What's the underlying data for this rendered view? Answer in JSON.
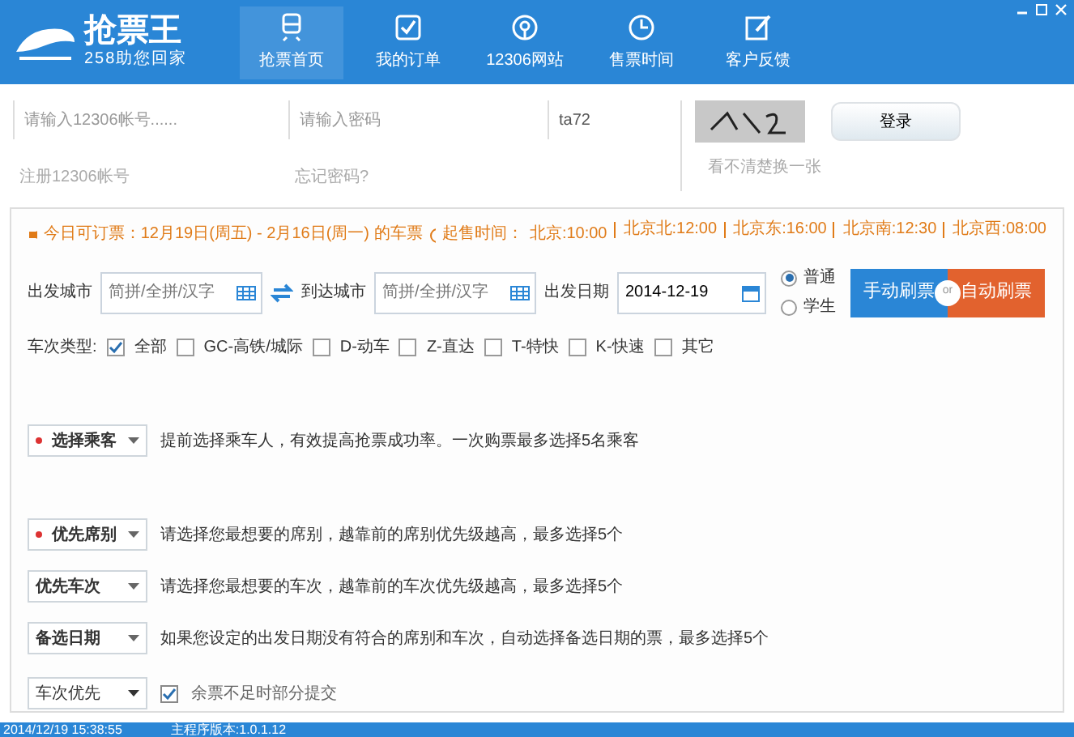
{
  "header": {
    "logo": "抢票王",
    "slogan": "258助您回家",
    "nav": [
      {
        "label": "抢票首页",
        "selected": true
      },
      {
        "label": "我的订单",
        "selected": false
      },
      {
        "label": "12306网站",
        "selected": false
      },
      {
        "label": "售票时间",
        "selected": false
      },
      {
        "label": "客户反馈",
        "selected": false
      }
    ]
  },
  "login": {
    "account": {
      "placeholder": "请输入12306帐号......"
    },
    "password": {
      "placeholder": "请输入密码"
    },
    "captcha": {
      "value": "ta72"
    },
    "login_button": "登录",
    "register_link": "注册12306帐号",
    "forgot_link": "忘记密码?",
    "refresh_captcha_link": "看不清楚换一张"
  },
  "notice": {
    "text": "今日可订票：12月19日(周五) - 2月16日(周一) 的车票",
    "sale_label": "起售时间：",
    "sale_times": [
      "北京:10:00",
      "北京北:12:00",
      "北京东:16:00",
      "北京南:12:30",
      "北京西:08:00"
    ]
  },
  "search": {
    "from_label": "出发城市",
    "from": {
      "placeholder": "简拼/全拼/汉字"
    },
    "to_label": "到达城市",
    "to": {
      "placeholder": "简拼/全拼/汉字"
    },
    "date_label": "出发日期",
    "date": "2014-12-19",
    "ticket_types": [
      {
        "label": "普通",
        "selected": true
      },
      {
        "label": "学生",
        "selected": false
      }
    ],
    "manual_button": "手动刷票",
    "or": "or",
    "auto_button": "自动刷票"
  },
  "train_types": {
    "label": "车次类型:",
    "options": [
      {
        "label": "全部",
        "checked": true
      },
      {
        "label": "GC-高铁/城际",
        "checked": false
      },
      {
        "label": "D-动车",
        "checked": false
      },
      {
        "label": "Z-直达",
        "checked": false
      },
      {
        "label": "T-特快",
        "checked": false
      },
      {
        "label": "K-快速",
        "checked": false
      },
      {
        "label": "其它",
        "checked": false
      }
    ]
  },
  "options": [
    {
      "button": "选择乘客",
      "required": true,
      "description": "提前选择乘车人，有效提高抢票成功率。一次购票最多选择5名乘客"
    },
    {
      "button": "优先席别",
      "required": true,
      "description": "请选择您最想要的席别，越靠前的席别优先级越高，最多选择5个"
    },
    {
      "button": "优先车次",
      "required": false,
      "description": "请选择您最想要的车次，越靠前的车次优先级越高，最多选择5个"
    },
    {
      "button": "备选日期",
      "required": false,
      "description": "如果您设定的出发日期没有符合的席别和车次，自动选择备选日期的票，最多选择5个"
    }
  ],
  "priority": {
    "value": "车次优先",
    "partial_submit": {
      "label": "余票不足时部分提交",
      "checked": true
    }
  },
  "status_bar": {
    "time": "2014/12/19 15:38:55",
    "version": "主程序版本:1.0.1.12"
  }
}
